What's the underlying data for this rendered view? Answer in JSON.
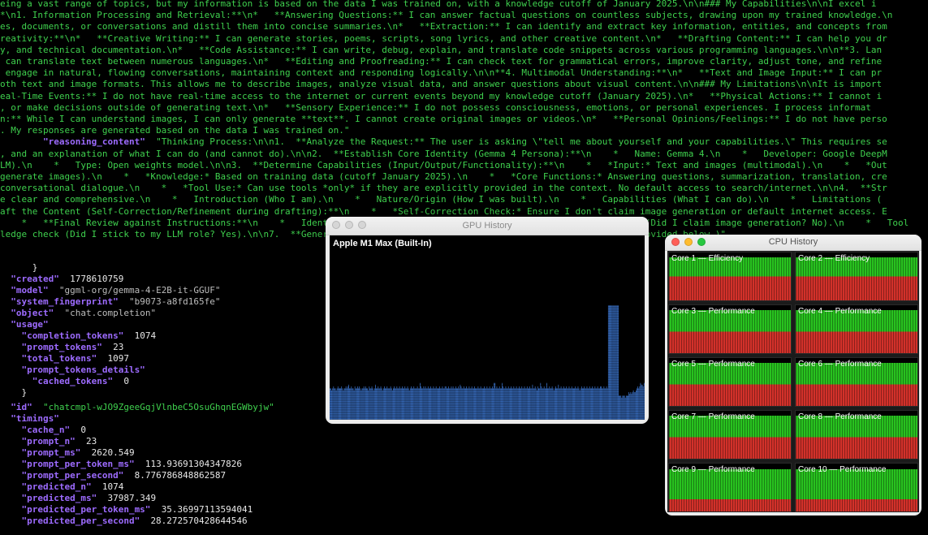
{
  "terminal": {
    "log_lines": [
      "eing a vast range of topics, but my information is based on the data I was trained on, with a knowledge cutoff of January 2025.\\n\\n### My Capabilities\\n\\nI excel i",
      "*\\n1. Information Processing and Retrieval:**\\n*   **Answering Questions:** I can answer factual questions on countless subjects, drawing upon my trained knowledge.\\n",
      "es, documents, or conversations and distill them into concise summaries.\\n*   **Extraction:** I can identify and extract key information, entities, and concepts from",
      "reativity:**\\n*   **Creative Writing:** I can generate stories, poems, scripts, song lyrics, and other creative content.\\n*   **Drafting Content:** I can help you dr",
      "y, and technical documentation.\\n*   **Code Assistance:** I can write, debug, explain, and translate code snippets across various programming languages.\\n\\n**3. Lan",
      " can translate text between numerous languages.\\n*   **Editing and Proofreading:** I can check text for grammatical errors, improve clarity, adjust tone, and refine",
      " engage in natural, flowing conversations, maintaining context and responding logically.\\n\\n**4. Multimodal Understanding:**\\n*   **Text and Image Input:** I can pr",
      "oth text and image formats. This allows me to describe images, analyze visual data, and answer questions about visual content.\\n\\n### My Limitations\\n\\nIt is import",
      "eal-Time Events:** I do not have real-time access to the internet or current events beyond my knowledge cutoff (January 2025).\\n*   **Physical Actions:** I cannot i",
      ", or make decisions outside of generating text.\\n*   **Sensory Experience:** I do not possess consciousness, emotions, or personal experiences. I process informat",
      "n:** While I can understand images, I can only generate **text**. I cannot create original images or videos.\\n*   **Personal Opinions/Feelings:** I do not have perso",
      ". My responses are generated based on the data I was trained on.\"",
      "        \"reasoning_content\"  \"Thinking Process:\\n\\n1.  **Analyze the Request:** The user is asking \\\"tell me about yourself and your capabilities.\\\" This requires se",
      ", and an explanation of what I can do (and cannot do).\\n\\n2.  **Establish Core Identity (Gemma 4 Persona):**\\n    *   Name: Gemma 4.\\n    *   Developer: Google DeepM",
      "LM).\\n    *   Type: Open weights model.\\n\\n3.  **Determine Capabilities (Input/Output/Functionality):**\\n    *   *Input:* Text and images (multimodal).\\n    *   *Out",
      "generate images).\\n    *   *Knowledge:* Based on training data (cutoff January 2025).\\n    *   *Core Functions:* Answering questions, summarization, translation, cre",
      "conversational dialogue.\\n    *   *Tool Use:* Can use tools *only* if they are explicitly provided in the context. No default access to search/internet.\\n\\n4.  **Str",
      "e clear and comprehensive.\\n    *   Introduction (Who I am).\\n    *   Nature/Origin (How I was built).\\n    *   Capabilities (What I can do).\\n    *   Limitations (",
      "aft the Content (Self-Correction/Refinement during drafting):**\\n    *   *Self-Correction Check:* Ensure I don't claim image generation or default internet access. E",
      "    *   **Final Review against Instructions:**\\n    *   Identity check (Am I Gemma 4? Yes).\\n    *   Capabilities check (Did I claim image generation? No).\\n    *   Tool",
      "ledge check (Did I stick to my LLM role? Yes).\\n\\n7.  **Generate Final Output.** (This leads to the detailed response provided below.)\""
    ],
    "brace_1": "      }",
    "brace_2": "    }",
    "fields": {
      "created_key": "  \"created\"",
      "created_val": "1778610759",
      "model_key": "  \"model\"",
      "model_val": "\"ggml-org/gemma-4-E2B-it-GGUF\"",
      "fingerprint_key": "  \"system_fingerprint\"",
      "fingerprint_val": "\"b9073-a8fd165fe\"",
      "object_key": "  \"object\"",
      "object_val": "\"chat.completion\"",
      "usage_key": "  \"usage\"",
      "completion_tokens_key": "    \"completion_tokens\"",
      "completion_tokens_val": "1074",
      "prompt_tokens_key": "    \"prompt_tokens\"",
      "prompt_tokens_val": "23",
      "total_tokens_key": "    \"total_tokens\"",
      "total_tokens_val": "1097",
      "prompt_tokens_details_key": "    \"prompt_tokens_details\"",
      "cached_tokens_key": "      \"cached_tokens\"",
      "cached_tokens_val": "0",
      "id_key": "  \"id\"",
      "id_val": "\"chatcmpl-wJO9ZgeeGqjVlnbeC5OsuGhqnEGWbyjw\"",
      "timings_key": "  \"timings\"",
      "cache_n_key": "    \"cache_n\"",
      "cache_n_val": "0",
      "prompt_n_key": "    \"prompt_n\"",
      "prompt_n_val": "23",
      "prompt_ms_key": "    \"prompt_ms\"",
      "prompt_ms_val": "2620.549",
      "prompt_per_token_ms_key": "    \"prompt_per_token_ms\"",
      "prompt_per_token_ms_val": "113.93691304347826",
      "prompt_per_second_key": "    \"prompt_per_second\"",
      "prompt_per_second_val": "8.776786848862587",
      "predicted_n_key": "    \"predicted_n\"",
      "predicted_n_val": "1074",
      "predicted_ms_key": "    \"predicted_ms\"",
      "predicted_ms_val": "37987.349",
      "predicted_per_token_ms_key": "    \"predicted_per_token_ms\"",
      "predicted_per_token_ms_val": "35.36997113594041",
      "predicted_per_second_key": "    \"predicted_per_second\"",
      "predicted_per_second_val": "28.272570428644546"
    }
  },
  "gpu_window": {
    "title": "GPU History",
    "gpu_name": "Apple M1 Max (Built-In)",
    "bar_color": "#3f7ad6",
    "usage_history": [
      0.17,
      0.17,
      0.16,
      0.17,
      0.18,
      0.17,
      0.17,
      0.16,
      0.17,
      0.18,
      0.17,
      0.17,
      0.17,
      0.18,
      0.17,
      0.16,
      0.17,
      0.17,
      0.18,
      0.17,
      0.18,
      0.19,
      0.17,
      0.17,
      0.18,
      0.17,
      0.17,
      0.16,
      0.18,
      0.17,
      0.17,
      0.18,
      0.17,
      0.18,
      0.17,
      0.16,
      0.17,
      0.17,
      0.18,
      0.17,
      0.18,
      0.17,
      0.17,
      0.16,
      0.18,
      0.17,
      0.17,
      0.18,
      0.17,
      0.16,
      0.17,
      0.19,
      0.17,
      0.17,
      0.18,
      0.17,
      0.17,
      0.18,
      0.17,
      0.16,
      0.17,
      0.18,
      0.17,
      0.17,
      0.18,
      0.17,
      0.17,
      0.17,
      0.18,
      0.17,
      0.16,
      0.17,
      0.18,
      0.17,
      0.17,
      0.18,
      0.17,
      0.17,
      0.18,
      0.17,
      0.17,
      0.18,
      0.17,
      0.17,
      0.18,
      0.17,
      0.17,
      0.18,
      0.17,
      0.16,
      0.17,
      0.18,
      0.17,
      0.17,
      0.18,
      0.17,
      0.17,
      0.17,
      0.18,
      0.17,
      0.17,
      0.2,
      0.18,
      0.17,
      0.17,
      0.18,
      0.17,
      0.18,
      0.17,
      0.17,
      0.18,
      0.17,
      0.17,
      0.18,
      0.17,
      0.17,
      0.18,
      0.17,
      0.17,
      0.18,
      0.17,
      0.17,
      0.17,
      0.18,
      0.17,
      0.17,
      0.18,
      0.17,
      0.17,
      0.18,
      0.18,
      0.17,
      0.17,
      0.18,
      0.17,
      0.17,
      0.18,
      0.17,
      0.18,
      0.17,
      0.17,
      0.18,
      0.17,
      0.17,
      0.18,
      0.17,
      0.19,
      0.18,
      0.17,
      0.17,
      0.18,
      0.17,
      0.17,
      0.18,
      0.17,
      0.17,
      0.18,
      0.17,
      0.17,
      0.18,
      0.17,
      0.17,
      0.18,
      0.17,
      0.17,
      0.17,
      0.18,
      0.17,
      0.17,
      0.18,
      0.17,
      0.17,
      0.17,
      0.18,
      0.17,
      0.17,
      0.18,
      0.17,
      0.17,
      0.18,
      0.17,
      0.17,
      0.18,
      0.17,
      0.2,
      0.2,
      0.17,
      0.18,
      0.17,
      0.17,
      0.18,
      0.17,
      0.17,
      0.2,
      0.18,
      0.17,
      0.17,
      0.18,
      0.17,
      0.17,
      0.18,
      0.17,
      0.17,
      0.18,
      0.17,
      0.17,
      0.18,
      0.17,
      0.17,
      0.18,
      0.17,
      0.17,
      0.18,
      0.17,
      0.17,
      0.18,
      0.17,
      0.17,
      0.18,
      0.17,
      0.17,
      0.18,
      0.17,
      0.17,
      0.18,
      0.17,
      0.17,
      0.19,
      0.17,
      0.17,
      0.18,
      0.17,
      0.16,
      0.18,
      0.17,
      0.17,
      0.2,
      0.18,
      0.17,
      0.17,
      0.18,
      0.17,
      0.17,
      0.2,
      0.17,
      0.17,
      0.18,
      0.17,
      0.17,
      0.18,
      0.17,
      0.16,
      0.17,
      0.18,
      0.17,
      0.17,
      0.19,
      0.17,
      0.17,
      0.18,
      0.17,
      0.17,
      0.18,
      0.17,
      0.17,
      0.18,
      0.17,
      0.17,
      0.18,
      0.17,
      0.17,
      0.18,
      0.17,
      0.17,
      0.17,
      0.18,
      0.17,
      0.17,
      0.18,
      0.17,
      0.16,
      0.17,
      0.18,
      0.17,
      0.17,
      0.18,
      0.17,
      0.17,
      0.18,
      0.17,
      0.17,
      0.18,
      0.17,
      0.17,
      0.18,
      0.17,
      0.17,
      0.18,
      0.17,
      0.17,
      0.18,
      0.17,
      0.17,
      0.18,
      0.18,
      0.17,
      0.17,
      0.18,
      0.17,
      0.17,
      0.18,
      0.17,
      0.62,
      0.62,
      0.62,
      0.62,
      0.62,
      0.62,
      0.62,
      0.62,
      0.62,
      0.62,
      0.62,
      0.62,
      0.13,
      0.13,
      0.13,
      0.12,
      0.13,
      0.13,
      0.13,
      0.12,
      0.13,
      0.13,
      0.13,
      0.15,
      0.14,
      0.15,
      0.14,
      0.15,
      0.16,
      0.15,
      0.15,
      0.16,
      0.17,
      0.18,
      0.17,
      0.18,
      0.2,
      0.19,
      0.19,
      0.18,
      0.2
    ]
  },
  "cpu_window": {
    "title": "CPU History",
    "colors": {
      "user": "#28c21f",
      "system": "#d2312a",
      "idle": "#000000"
    },
    "cores": [
      {
        "label": "Core 1 — Efficiency",
        "idle": 0.1,
        "user": 0.4
      },
      {
        "label": "Core 2 — Efficiency",
        "idle": 0.1,
        "user": 0.4
      },
      {
        "label": "Core 3 — Performance",
        "idle": 0.1,
        "user": 0.45
      },
      {
        "label": "Core 4 — Performance",
        "idle": 0.1,
        "user": 0.45
      },
      {
        "label": "Core 5 — Performance",
        "idle": 0.1,
        "user": 0.45
      },
      {
        "label": "Core 6 — Performance",
        "idle": 0.1,
        "user": 0.45
      },
      {
        "label": "Core 7 — Performance",
        "idle": 0.1,
        "user": 0.45
      },
      {
        "label": "Core 8 — Performance",
        "idle": 0.1,
        "user": 0.45
      },
      {
        "label": "Core 9 — Performance",
        "idle": 0.12,
        "user": 0.63
      },
      {
        "label": "Core 10 — Performance",
        "idle": 0.12,
        "user": 0.63
      }
    ]
  }
}
